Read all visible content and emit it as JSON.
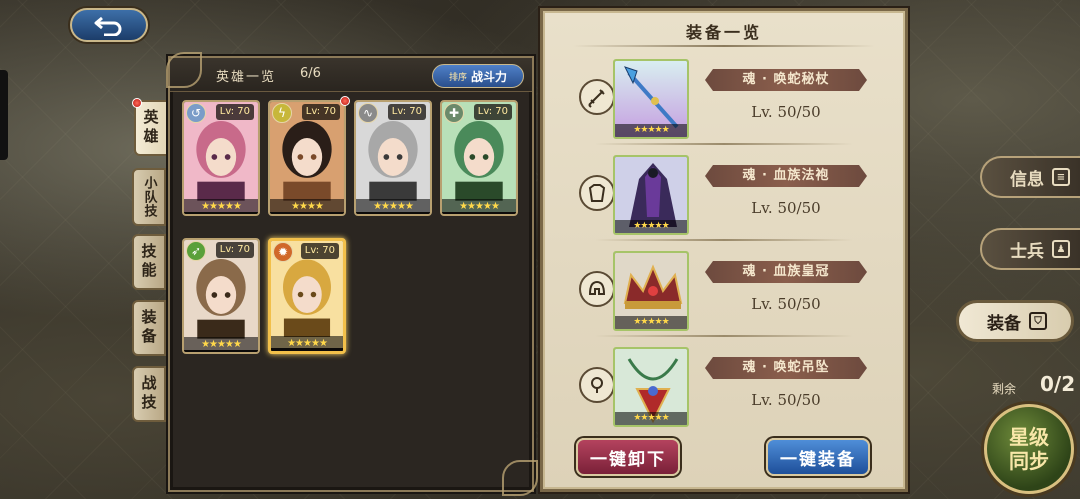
{
  "hero_panel": {
    "title": "英雄一览",
    "count": "6/6",
    "sort_small": "排序",
    "sort_label": "战斗力"
  },
  "side_tabs": [
    {
      "label": "英雄",
      "active": true
    },
    {
      "label": "小队技",
      "active": false
    },
    {
      "label": "技能",
      "active": false
    },
    {
      "label": "装备",
      "active": false
    },
    {
      "label": "战技",
      "active": false
    }
  ],
  "heroes": [
    {
      "level": "Lv: 70",
      "stars": "★★★★★",
      "element": "wind",
      "elem_color": "#7a9cc8",
      "selected": false
    },
    {
      "level": "Lv: 70",
      "stars": "★★★★",
      "element": "lightning",
      "elem_color": "#c7b73a",
      "selected": false
    },
    {
      "level": "Lv: 70",
      "stars": "★★★★★",
      "element": "swirl",
      "elem_color": "#8a8a8a",
      "selected": false
    },
    {
      "level": "Lv: 70",
      "stars": "★★★★★",
      "element": "cross",
      "elem_color": "#6b8a6b",
      "selected": false
    },
    {
      "level": "Lv: 70",
      "stars": "★★★★★",
      "element": "arrow",
      "elem_color": "#5aa03a",
      "selected": false
    },
    {
      "level": "Lv: 70",
      "stars": "★★★★★",
      "element": "fire",
      "elem_color": "#d0682a",
      "selected": true
    }
  ],
  "equip_panel": {
    "title": "装备一览",
    "items": [
      {
        "slot_icon": "sword-icon",
        "name": "魂 · 唤蛇秘杖",
        "level": "Lv. 50/50",
        "stars": "★★★★★"
      },
      {
        "slot_icon": "armor-icon",
        "name": "魂 · 血族法袍",
        "level": "Lv. 50/50",
        "stars": "★★★★★"
      },
      {
        "slot_icon": "helmet-icon",
        "name": "魂 · 血族皇冠",
        "level": "Lv. 50/50",
        "stars": "★★★★★"
      },
      {
        "slot_icon": "accessory-icon",
        "name": "魂 · 唤蛇吊坠",
        "level": "Lv. 50/50",
        "stars": "★★★★★"
      }
    ],
    "unequip_label": "一键卸下",
    "equip_label": "一键装备"
  },
  "right_menu": {
    "info_label": "信息",
    "soldier_label": "士兵",
    "equip_label": "装备",
    "remain_label": "剩余",
    "remain_value": "0/2",
    "sync_line1": "星级",
    "sync_line2": "同步"
  },
  "colors": {
    "accent_gold": "#f2c04a",
    "unequip_red": "#b4435e",
    "equip_blue": "#4f8ed8"
  }
}
